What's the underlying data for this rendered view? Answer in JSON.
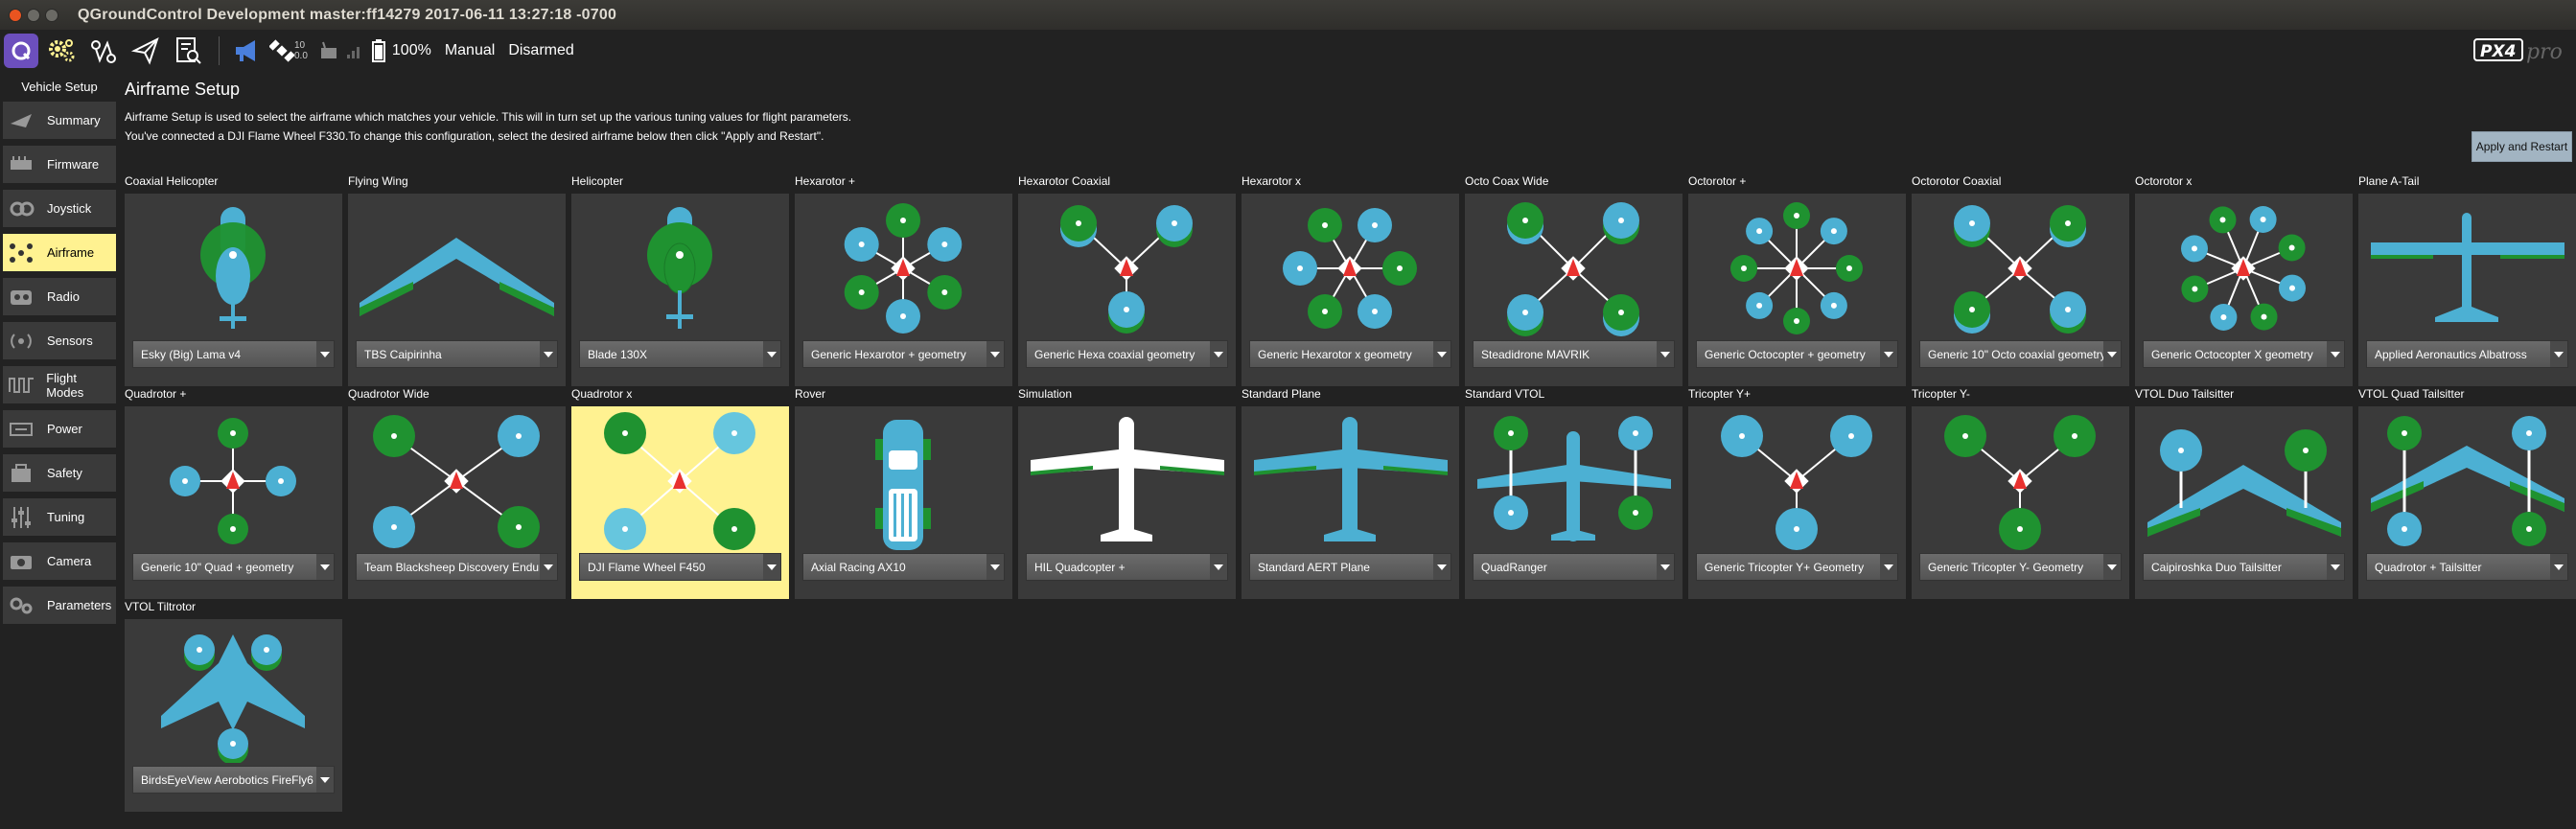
{
  "window": {
    "title": "QGroundControl Development master:ff14279 2017-06-11 13:27:18 -0700"
  },
  "toolbar": {
    "gps_count": "10",
    "gps_hdop": "0.0",
    "battery": "100%",
    "flight_mode": "Manual",
    "arm_state": "Disarmed"
  },
  "sidebar": {
    "title": "Vehicle Setup",
    "items": [
      {
        "label": "Summary",
        "icon": "summary-icon"
      },
      {
        "label": "Firmware",
        "icon": "firmware-icon"
      },
      {
        "label": "Joystick",
        "icon": "joystick-icon"
      },
      {
        "label": "Airframe",
        "icon": "airframe-icon",
        "active": true
      },
      {
        "label": "Radio",
        "icon": "radio-icon"
      },
      {
        "label": "Sensors",
        "icon": "sensors-icon"
      },
      {
        "label": "Flight Modes",
        "icon": "flight-modes-icon"
      },
      {
        "label": "Power",
        "icon": "power-icon"
      },
      {
        "label": "Safety",
        "icon": "safety-icon"
      },
      {
        "label": "Tuning",
        "icon": "tuning-icon"
      },
      {
        "label": "Camera",
        "icon": "camera-icon"
      },
      {
        "label": "Parameters",
        "icon": "parameters-icon"
      }
    ]
  },
  "main": {
    "title": "Airframe Setup",
    "desc1": "Airframe Setup is used to select the airframe which matches your vehicle. This will in turn set up the various tuning values for flight parameters.",
    "desc2": "You've connected a DJI Flame Wheel F330.To change this configuration, select the desired airframe below then click \"Apply and Restart\".",
    "apply_label": "Apply and Restart"
  },
  "airframes": [
    {
      "label": "Coaxial Helicopter",
      "selection": "Esky (Big) Lama v4",
      "art": "heli-coax"
    },
    {
      "label": "Flying Wing",
      "selection": "TBS Caipirinha",
      "art": "wing"
    },
    {
      "label": "Helicopter",
      "selection": "Blade 130X",
      "art": "heli"
    },
    {
      "label": "Hexarotor +",
      "selection": "Generic Hexarotor + geometry",
      "art": "hex-plus"
    },
    {
      "label": "Hexarotor Coaxial",
      "selection": "Generic Hexa coaxial geometry",
      "art": "hex-coax"
    },
    {
      "label": "Hexarotor x",
      "selection": "Generic Hexarotor x geometry",
      "art": "hex-x"
    },
    {
      "label": "Octo Coax Wide",
      "selection": "Steadidrone MAVRIK",
      "art": "octo-coax-wide"
    },
    {
      "label": "Octorotor +",
      "selection": "Generic Octocopter + geometry",
      "art": "octo-plus"
    },
    {
      "label": "Octorotor Coaxial",
      "selection": "Generic 10\" Octo coaxial geometry",
      "art": "octo-coax"
    },
    {
      "label": "Octorotor x",
      "selection": "Generic Octocopter X geometry",
      "art": "octo-x"
    },
    {
      "label": "Plane A-Tail",
      "selection": "Applied Aeronautics Albatross",
      "art": "plane-atail"
    },
    {
      "label": "Quadrotor +",
      "selection": "Generic 10\" Quad + geometry",
      "art": "quad-plus"
    },
    {
      "label": "Quadrotor Wide",
      "selection": "Team Blacksheep Discovery Endurance",
      "art": "quad-wide"
    },
    {
      "label": "Quadrotor x",
      "selection": "DJI Flame Wheel F450",
      "art": "quad-x",
      "selected": true
    },
    {
      "label": "Rover",
      "selection": "Axial Racing AX10",
      "art": "rover"
    },
    {
      "label": "Simulation",
      "selection": "HIL Quadcopter +",
      "art": "sim"
    },
    {
      "label": "Standard Plane",
      "selection": "Standard AERT Plane",
      "art": "plane"
    },
    {
      "label": "Standard VTOL",
      "selection": "QuadRanger",
      "art": "vtol"
    },
    {
      "label": "Tricopter Y+",
      "selection": "Generic Tricopter Y+ Geometry",
      "art": "tri-plus"
    },
    {
      "label": "Tricopter Y-",
      "selection": "Generic Tricopter Y- Geometry",
      "art": "tri-minus"
    },
    {
      "label": "VTOL Duo Tailsitter",
      "selection": "Caipiroshka Duo Tailsitter",
      "art": "duo-tailsitter"
    },
    {
      "label": "VTOL Quad Tailsitter",
      "selection": "Quadrotor + Tailsitter",
      "art": "quad-tailsitter"
    },
    {
      "label": "VTOL Tiltrotor",
      "selection": "BirdsEyeView Aerobotics FireFly6",
      "art": "tiltrotor"
    }
  ],
  "colors": {
    "background": "#222222",
    "card": "#3a3a3a",
    "selected": "#fff291",
    "blue": "#4cb0d3",
    "green": "#1f9230",
    "red": "#e8312f"
  }
}
